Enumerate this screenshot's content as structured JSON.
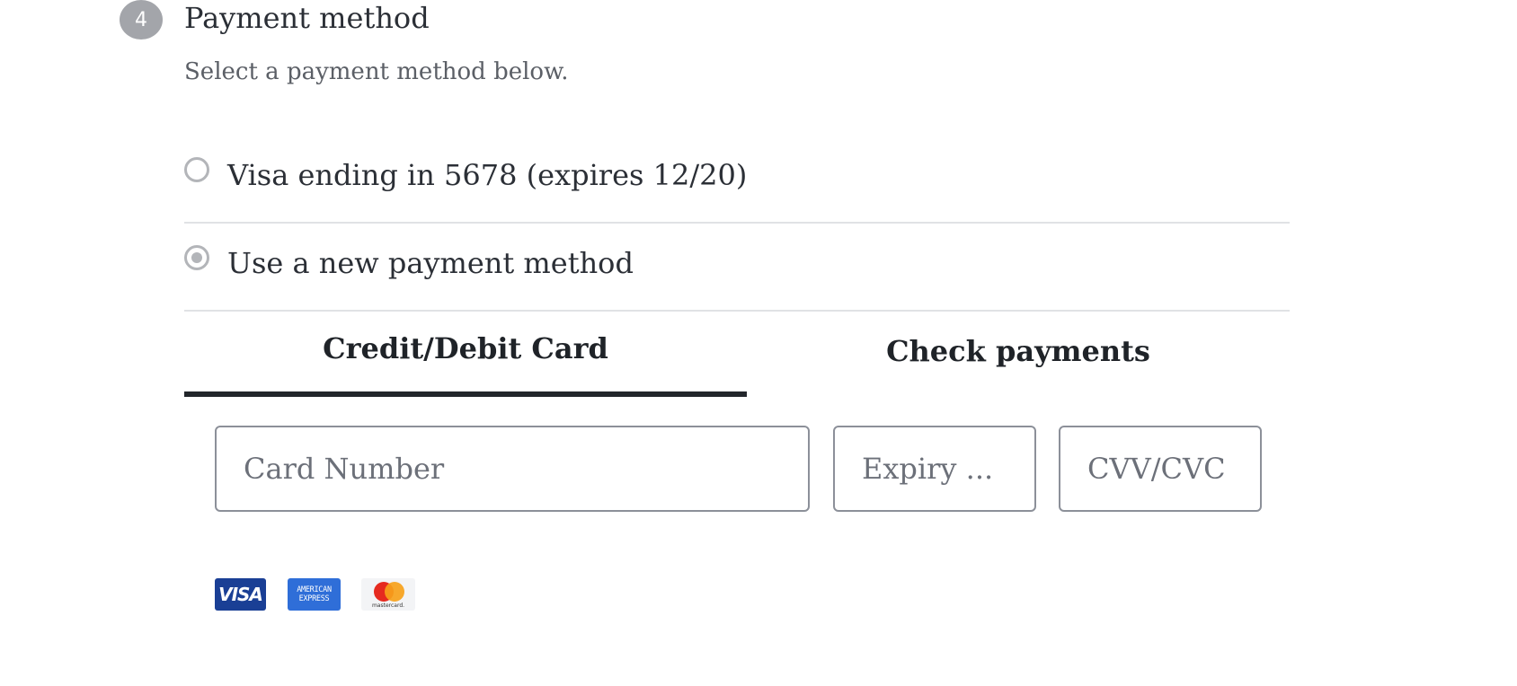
{
  "section": {
    "step_number": "4",
    "title": "Payment method",
    "subtitle": "Select a payment method below."
  },
  "payment_options": [
    {
      "label": "Visa ending in 5678 (expires 12/20)",
      "selected": false
    },
    {
      "label": "Use a new payment method",
      "selected": true
    }
  ],
  "tabs": [
    {
      "label": "Credit/Debit Card",
      "active": true
    },
    {
      "label": "Check payments",
      "active": false
    }
  ],
  "card_form": {
    "card_number_placeholder": "Card Number",
    "expiry_placeholder": "Expiry ...",
    "cvv_placeholder": "CVV/CVC"
  },
  "card_logos": {
    "visa": "VISA",
    "amex_line1": "AMERICAN",
    "amex_line2": "EXPRESS",
    "mastercard": "mastercard."
  },
  "colors": {
    "badge": "#a3a5aa",
    "active_tab_underline": "#22262b",
    "divider": "#e0e2e5"
  }
}
